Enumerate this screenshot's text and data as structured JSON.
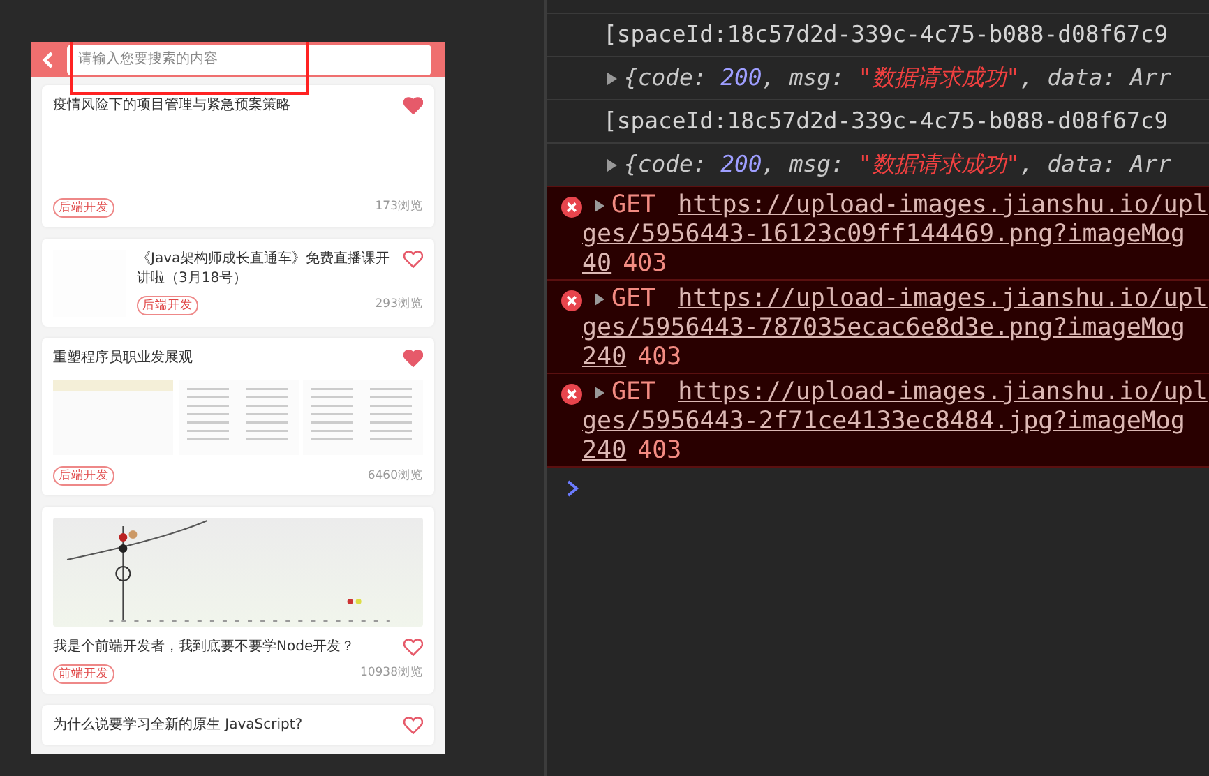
{
  "app": {
    "search": {
      "placeholder": "请输入您要搜索的内容",
      "highlighted": true
    },
    "articles": [
      {
        "title": "疫情风险下的项目管理与紧急预案策略",
        "kind": "blank",
        "tag": "后端开发",
        "views": "173浏览",
        "liked": true
      },
      {
        "title": "《Java架构师成长直通车》免费直播课开讲啦（3月18号）",
        "kind": "side",
        "tag": "后端开发",
        "views": "293浏览",
        "liked": false
      },
      {
        "title": "重塑程序员职业发展观",
        "kind": "triple",
        "tag": "后端开发",
        "views": "6460浏览",
        "liked": true
      },
      {
        "title": "我是个前端开发者，我到底要不要学Node开发？",
        "kind": "banner",
        "tag": "前端开发",
        "views": "10938浏览",
        "liked": false
      },
      {
        "title": "为什么说要学习全新的原生 JavaScript?",
        "kind": "none",
        "liked": false
      }
    ]
  },
  "console": {
    "entries": [
      {
        "kind": "log",
        "text": "[spaceId:18c57d2d-339c-4c75-b088-d08f67c9"
      },
      {
        "kind": "object",
        "parts": [
          {
            "kind": "plain",
            "text": "{code: "
          },
          {
            "kind": "number",
            "text": "200"
          },
          {
            "kind": "plain",
            "text": ", msg: "
          },
          {
            "kind": "string",
            "text": "\"数据请求成功\""
          },
          {
            "kind": "plain",
            "text": ", data: Arr"
          }
        ]
      },
      {
        "kind": "log",
        "text": "[spaceId:18c57d2d-339c-4c75-b088-d08f67c9"
      },
      {
        "kind": "object",
        "parts": [
          {
            "kind": "plain",
            "text": "{code: "
          },
          {
            "kind": "number",
            "text": "200"
          },
          {
            "kind": "plain",
            "text": ", msg: "
          },
          {
            "kind": "string",
            "text": "\"数据请求成功\""
          },
          {
            "kind": "plain",
            "text": ", data: Arr"
          }
        ]
      },
      {
        "kind": "error",
        "method": "GET",
        "url_lines": [
          "https://upload-images.jianshu.io/upl",
          "ges/5956443-16123c09ff144469.png?imageMog"
        ],
        "url_tail": "40",
        "status": "403"
      },
      {
        "kind": "error",
        "method": "GET",
        "url_lines": [
          "https://upload-images.jianshu.io/upl",
          "ges/5956443-787035ecac6e8d3e.png?imageMog"
        ],
        "url_tail": "240",
        "status": "403"
      },
      {
        "kind": "error",
        "method": "GET",
        "url_lines": [
          "https://upload-images.jianshu.io/upl",
          "ges/5956443-2f71ce4133ec8484.jpg?imageMog"
        ],
        "url_tail": "240",
        "status": "403"
      }
    ]
  }
}
